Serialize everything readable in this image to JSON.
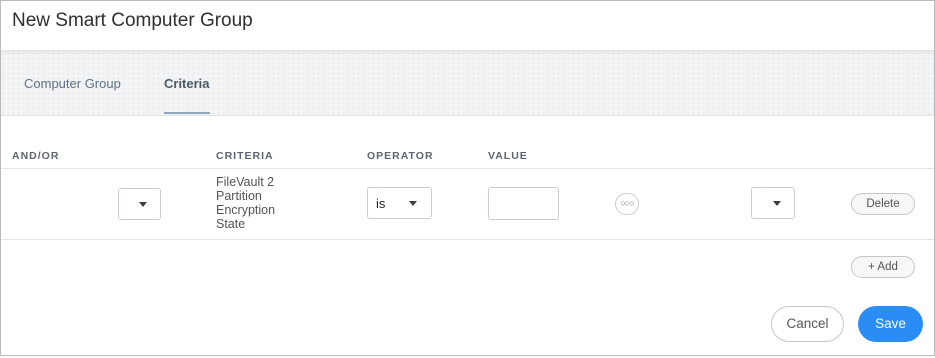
{
  "dialog": {
    "title": "New Smart Computer Group"
  },
  "tabs": [
    {
      "label": "Computer Group",
      "active": false
    },
    {
      "label": "Criteria",
      "active": true
    }
  ],
  "table": {
    "headers": {
      "and_or": "AND/OR",
      "criteria": "CRITERIA",
      "operator": "OPERATOR",
      "value": "VALUE"
    },
    "rows": [
      {
        "and_or": "",
        "criteria": "FileVault 2 Partition Encryption State",
        "operator": "is",
        "value": "",
        "paren_close": "",
        "more_icon": "ellipsis-icon",
        "delete_label": "Delete"
      }
    ]
  },
  "actions": {
    "add_label": "+ Add",
    "cancel_label": "Cancel",
    "save_label": "Save"
  },
  "colors": {
    "accent": "#2a8df5",
    "tab_text": "#5d7185"
  }
}
